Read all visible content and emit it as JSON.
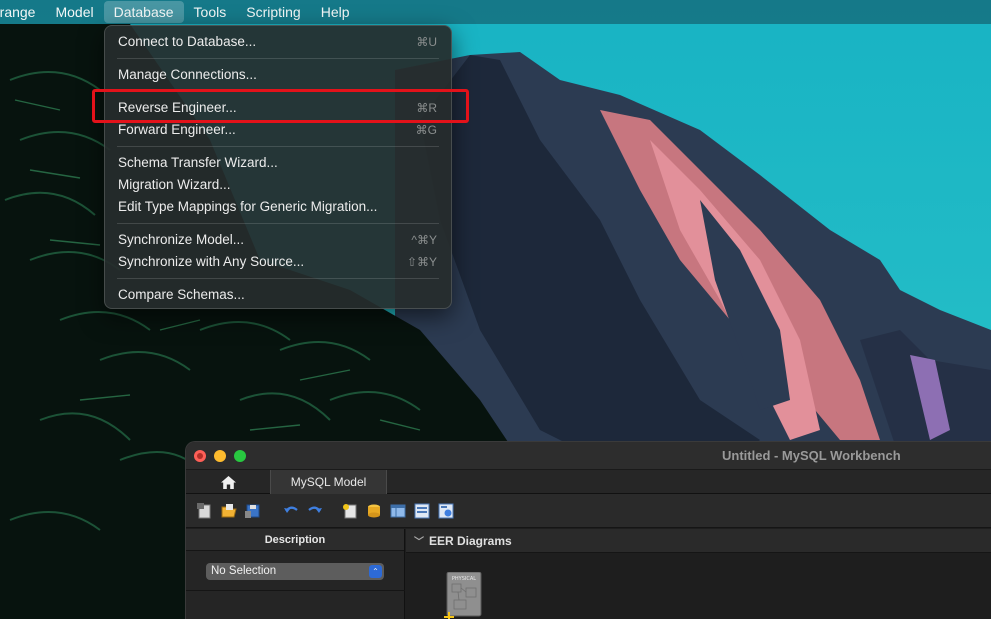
{
  "menubar": {
    "items": [
      {
        "label": "rrange"
      },
      {
        "label": "Model"
      },
      {
        "label": "Database"
      },
      {
        "label": "Tools"
      },
      {
        "label": "Scripting"
      },
      {
        "label": "Help"
      }
    ],
    "active_index": 2
  },
  "database_menu": {
    "items": [
      {
        "label": "Connect to Database...",
        "shortcut": "⌘U"
      },
      {
        "label": "Manage Connections...",
        "shortcut": ""
      },
      {
        "label": "Reverse Engineer...",
        "shortcut": "⌘R"
      },
      {
        "label": "Forward Engineer...",
        "shortcut": "⌘G"
      },
      {
        "label": "Schema Transfer Wizard...",
        "shortcut": ""
      },
      {
        "label": "Migration Wizard...",
        "shortcut": ""
      },
      {
        "label": "Edit Type Mappings for Generic Migration...",
        "shortcut": ""
      },
      {
        "label": "Synchronize Model...",
        "shortcut": "^⌘Y"
      },
      {
        "label": "Synchronize with Any Source...",
        "shortcut": "⇧⌘Y"
      },
      {
        "label": "Compare Schemas...",
        "shortcut": ""
      }
    ],
    "highlighted_item": "Reverse Engineer..."
  },
  "workbench": {
    "title": "Untitled - MySQL Workbench",
    "tabs": {
      "model_tab": "MySQL Model"
    },
    "left_pane": {
      "header": "Description",
      "selection_value": "No Selection"
    },
    "eer_header": "EER Diagrams",
    "thumb_label": "PHYSICAL"
  },
  "colors": {
    "accent_highlight": "#e3121a",
    "select_chevron": "#2d6ad6"
  }
}
